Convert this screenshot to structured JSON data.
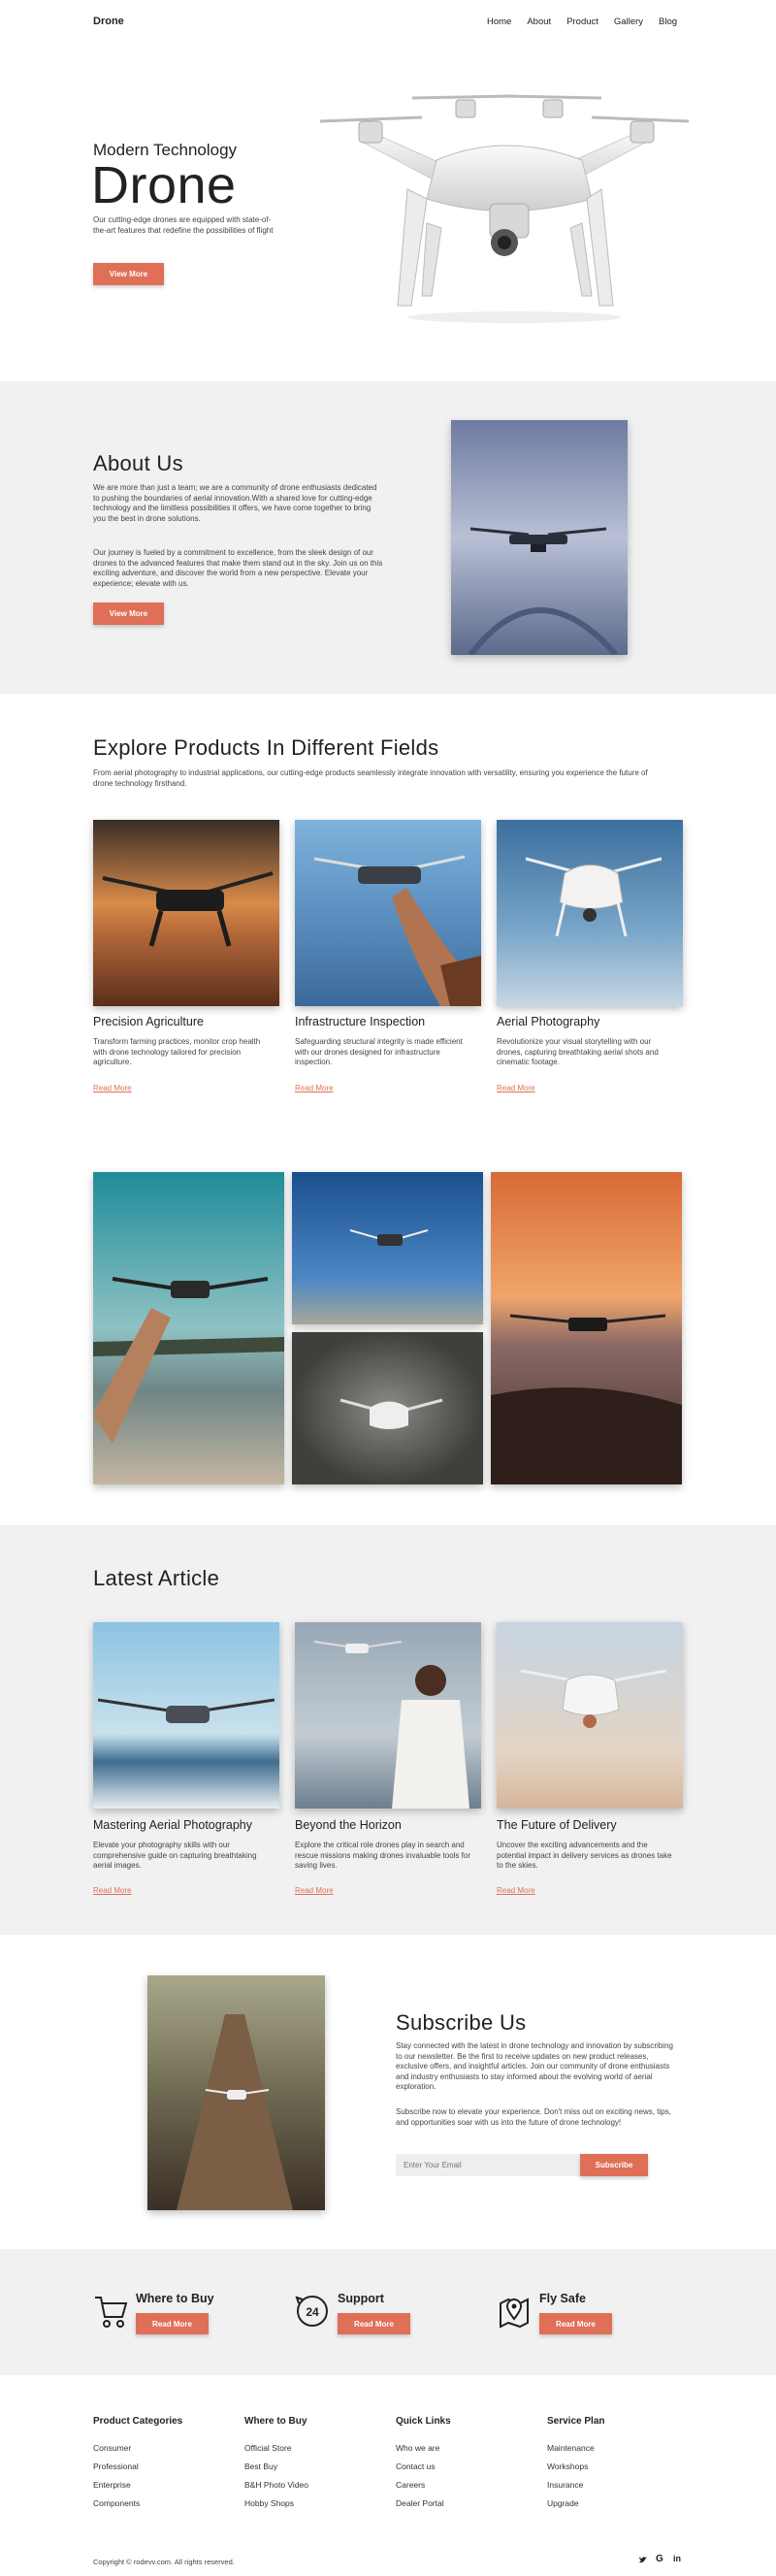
{
  "header": {
    "logo": "Drone",
    "nav": [
      "Home",
      "About",
      "Product",
      "Gallery",
      "Blog"
    ]
  },
  "hero": {
    "subtitle": "Modern Technology",
    "title": "Drone",
    "description": "Our cutting-edge drones are equipped with state-of-the-art features that redefine the possibilities of flight",
    "button": "View More"
  },
  "about": {
    "title": "About Us",
    "p1": "We are more than just a team; we are a community of drone enthusiasts dedicated to pushing the boundaries of aerial innovation.With a shared love for cutting-edge technology and the limitless possibilities it offers, we have come together to bring you the best in drone solutions.",
    "p2": "Our journey is fueled by a commitment to excellence, from the sleek design of our drones to the advanced features that make them stand out in the sky. Join us on this exciting adventure, and discover the world from a new perspective. Elevate your experience; elevate with us.",
    "button": "View More"
  },
  "products": {
    "title": "Explore Products In Different Fields",
    "intro": "From aerial photography to industrial applications, our cutting-edge products seamlessly integrate innovation with versatility, ensuring you experience the future of drone technology firsthand.",
    "cards": [
      {
        "title": "Precision Agriculture",
        "desc": "Transform farming practices, monitor crop health with drone technology tailored for precision agriculture.",
        "link": "Read More"
      },
      {
        "title": "Infrastructure Inspection",
        "desc": "Safeguarding structural integrity is made efficient with our drones designed for infrastructure inspection.",
        "link": "Read More"
      },
      {
        "title": "Aerial Photography",
        "desc": "Revolutionize your visual storytelling with our drones, capturing breathtaking aerial shots and cinematic footage.",
        "link": "Read More"
      }
    ]
  },
  "articles": {
    "title": "Latest Article",
    "cards": [
      {
        "title": "Mastering Aerial Photography",
        "desc": "Elevate your photography skills with our comprehensive guide on capturing breathtaking aerial images.",
        "link": "Read More"
      },
      {
        "title": "Beyond the Horizon",
        "desc": "Explore the critical role drones play in search and rescue missions making drones invaluable tools for saving lives.",
        "link": "Read More"
      },
      {
        "title": "The Future of Delivery",
        "desc": "Uncover the exciting advancements and the potential impact in delivery services as drones take to the skies.",
        "link": "Read More"
      }
    ]
  },
  "subscribe": {
    "title": "Subscribe Us",
    "p1": "Stay connected with the latest in drone technology and innovation by subscribing to our newsletter. Be the first to receive updates on new product releases, exclusive offers, and insightful articles. Join our community of drone enthusiasts and industry enthusiasts to stay informed about the evolving world of aerial exploration.",
    "p2": "Subscribe now to elevate your experience. Don't miss out on exciting news, tips, and opportunities soar with us into the future of drone technology!",
    "placeholder": "Enter Your Email",
    "button": "Subscribe"
  },
  "features": [
    {
      "title": "Where to Buy",
      "button": "Read More",
      "icon": "cart-icon"
    },
    {
      "title": "Support",
      "button": "Read More",
      "icon": "support-24-icon"
    },
    {
      "title": "Fly Safe",
      "button": "Read More",
      "icon": "map-pin-icon"
    }
  ],
  "footer": {
    "columns": [
      {
        "title": "Product Categories",
        "items": [
          "Consumer",
          "Professional",
          "Enterprise",
          "Components"
        ]
      },
      {
        "title": "Where to Buy",
        "items": [
          "Official Store",
          "Best Buy",
          "B&H Photo Video",
          "Hobby Shops"
        ]
      },
      {
        "title": "Quick Links",
        "items": [
          "Who we are",
          "Contact us",
          "Careers",
          "Dealer Portal"
        ]
      },
      {
        "title": "Service Plan",
        "items": [
          "Maintenance",
          "Workshops",
          "Insurance",
          "Upgrade"
        ]
      }
    ],
    "copyright": "Copyright © rodevv.com. All rights reserved.",
    "social": [
      "twitter-icon",
      "google-icon",
      "linkedin-icon"
    ]
  },
  "colors": {
    "accent": "#e06f57",
    "section_gray": "#f1f1f1"
  }
}
